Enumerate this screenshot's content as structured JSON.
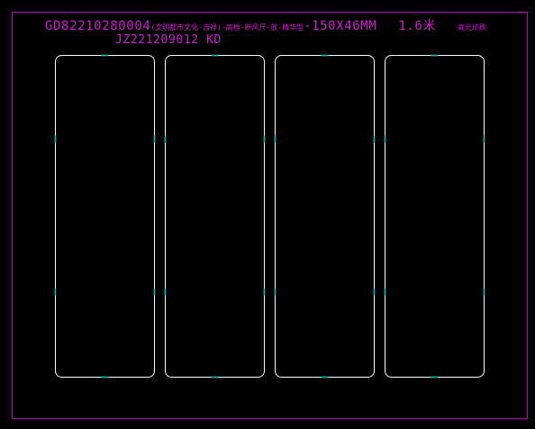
{
  "colors": {
    "background": "#000000",
    "frame": "#c000c0",
    "text": "#d41cd4",
    "panel_outline": "#ffffff",
    "tick_marks": "#00c8c8"
  },
  "header": {
    "code": "GD82210280004",
    "description": "(文明都市文化-吉祥)-高档-新风尺-放-精华型",
    "size": "-150X46MM",
    "thickness": "1.6米",
    "note": "高光印刷",
    "job_number": "JZ221209012 KD"
  },
  "panels": [
    {
      "name": "panel-1"
    },
    {
      "name": "panel-2"
    },
    {
      "name": "panel-3"
    },
    {
      "name": "panel-4"
    }
  ]
}
